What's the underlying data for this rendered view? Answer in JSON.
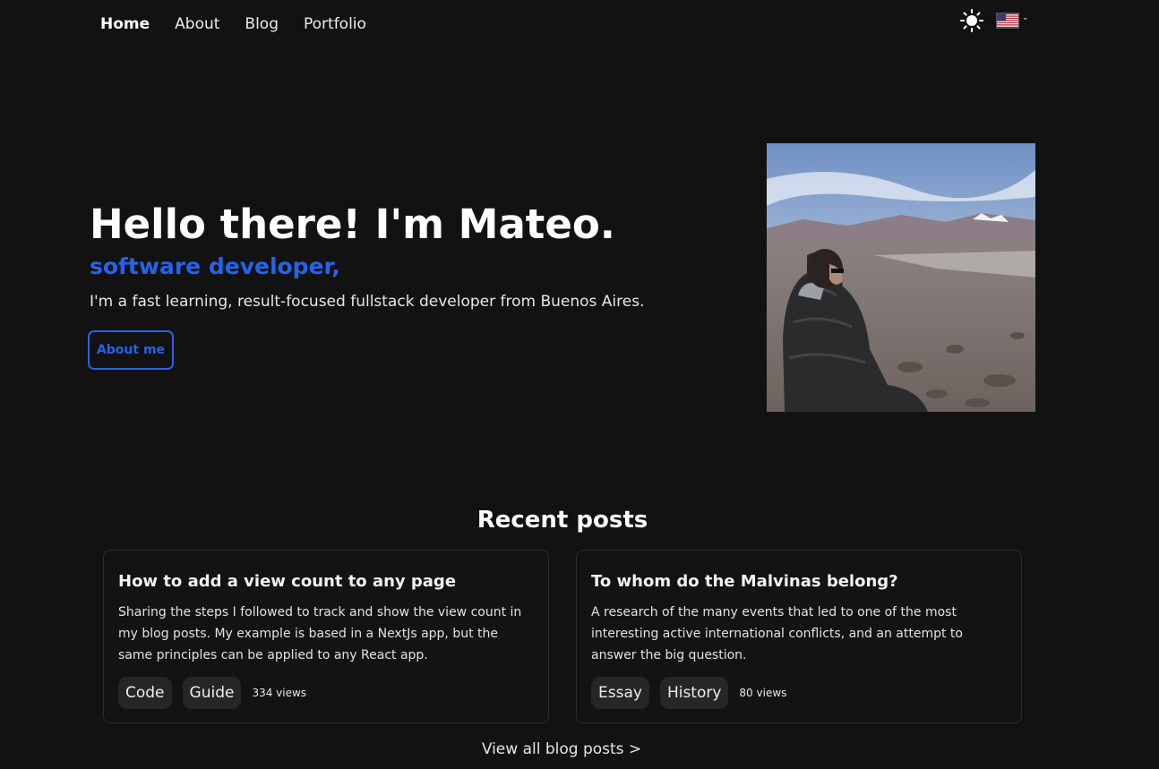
{
  "nav": {
    "items": [
      {
        "label": "Home",
        "active": true
      },
      {
        "label": "About"
      },
      {
        "label": "Blog"
      },
      {
        "label": "Portfolio"
      }
    ],
    "theme_icon": "sun-icon",
    "language_icon": "us-flag-icon"
  },
  "hero": {
    "title": "Hello there! I'm Mateo.",
    "subtitle": "software developer,",
    "description": "I'm a fast learning, result-focused fullstack developer from Buenos Aires.",
    "button_label": "About me",
    "accent_color": "#2563eb"
  },
  "recent": {
    "title": "Recent posts",
    "posts": [
      {
        "title": "How to add a view count to any page",
        "excerpt": "Sharing the steps I followed to track and show the view count in my blog posts. My example is based in a NextJs app, but the same principles can be applied to any React app.",
        "tags": [
          "Code",
          "Guide"
        ],
        "views": "334 views"
      },
      {
        "title": "To whom do the Malvinas belong?",
        "excerpt": "A research of the many events that led to one of the most interesting active international conflicts, and an attempt to answer the big question.",
        "tags": [
          "Essay",
          "History"
        ],
        "views": "80 views"
      }
    ],
    "view_all": "View all blog posts >"
  }
}
